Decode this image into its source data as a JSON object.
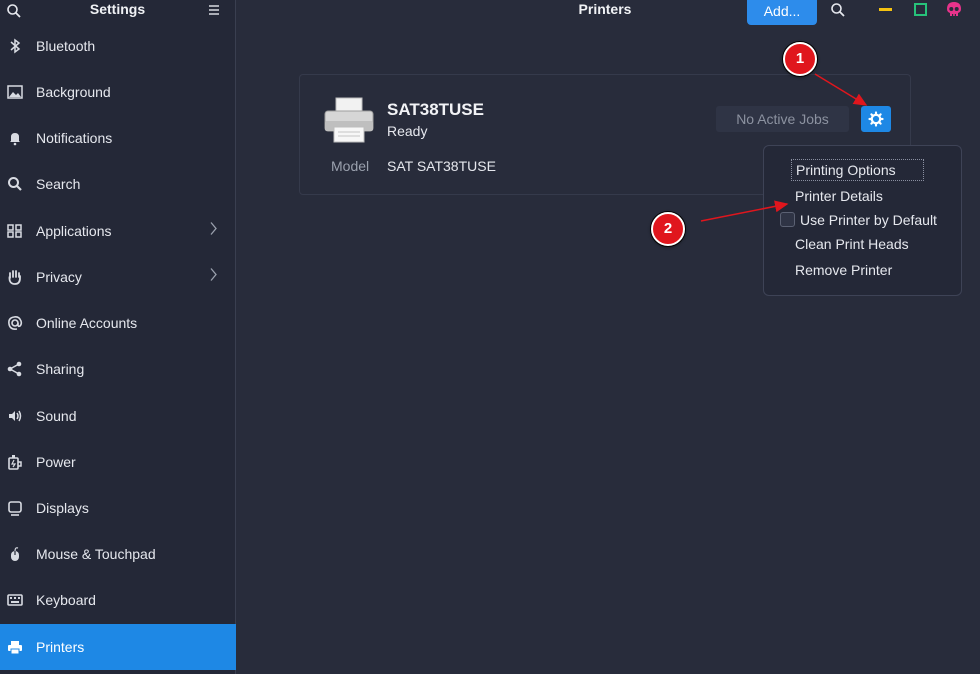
{
  "sidebar": {
    "title": "Settings",
    "items": [
      {
        "label": "Bluetooth",
        "icon": "bluetooth-icon"
      },
      {
        "label": "Background",
        "icon": "image-icon"
      },
      {
        "label": "Notifications",
        "icon": "bell-icon"
      },
      {
        "label": "Search",
        "icon": "search-icon"
      },
      {
        "label": "Applications",
        "icon": "grid-icon"
      },
      {
        "label": "Privacy",
        "icon": "hand-icon"
      },
      {
        "label": "Online Accounts",
        "icon": "at-icon"
      },
      {
        "label": "Sharing",
        "icon": "share-icon"
      },
      {
        "label": "Sound",
        "icon": "speaker-icon"
      },
      {
        "label": "Power",
        "icon": "power-icon"
      },
      {
        "label": "Displays",
        "icon": "monitor-icon"
      },
      {
        "label": "Mouse & Touchpad",
        "icon": "mouse-icon"
      },
      {
        "label": "Keyboard",
        "icon": "keyboard-icon"
      },
      {
        "label": "Printers",
        "icon": "printer-icon",
        "selected": true
      }
    ]
  },
  "header": {
    "title": "Printers",
    "add_label": "Add..."
  },
  "printer": {
    "name": "SAT38TUSE",
    "status": "Ready",
    "model_label": "Model",
    "model_value": "SAT SAT38TUSE",
    "jobs_label": "No Active Jobs"
  },
  "menu": {
    "items": [
      "Printing Options",
      "Printer Details",
      "Use Printer by Default",
      "Clean Print Heads",
      "Remove Printer"
    ],
    "default_checked": false
  },
  "annotations": {
    "badge1": "1",
    "badge2": "2"
  },
  "colors": {
    "accent": "#1e88e5",
    "badge": "#e0161d",
    "arrow": "#e0161d"
  }
}
